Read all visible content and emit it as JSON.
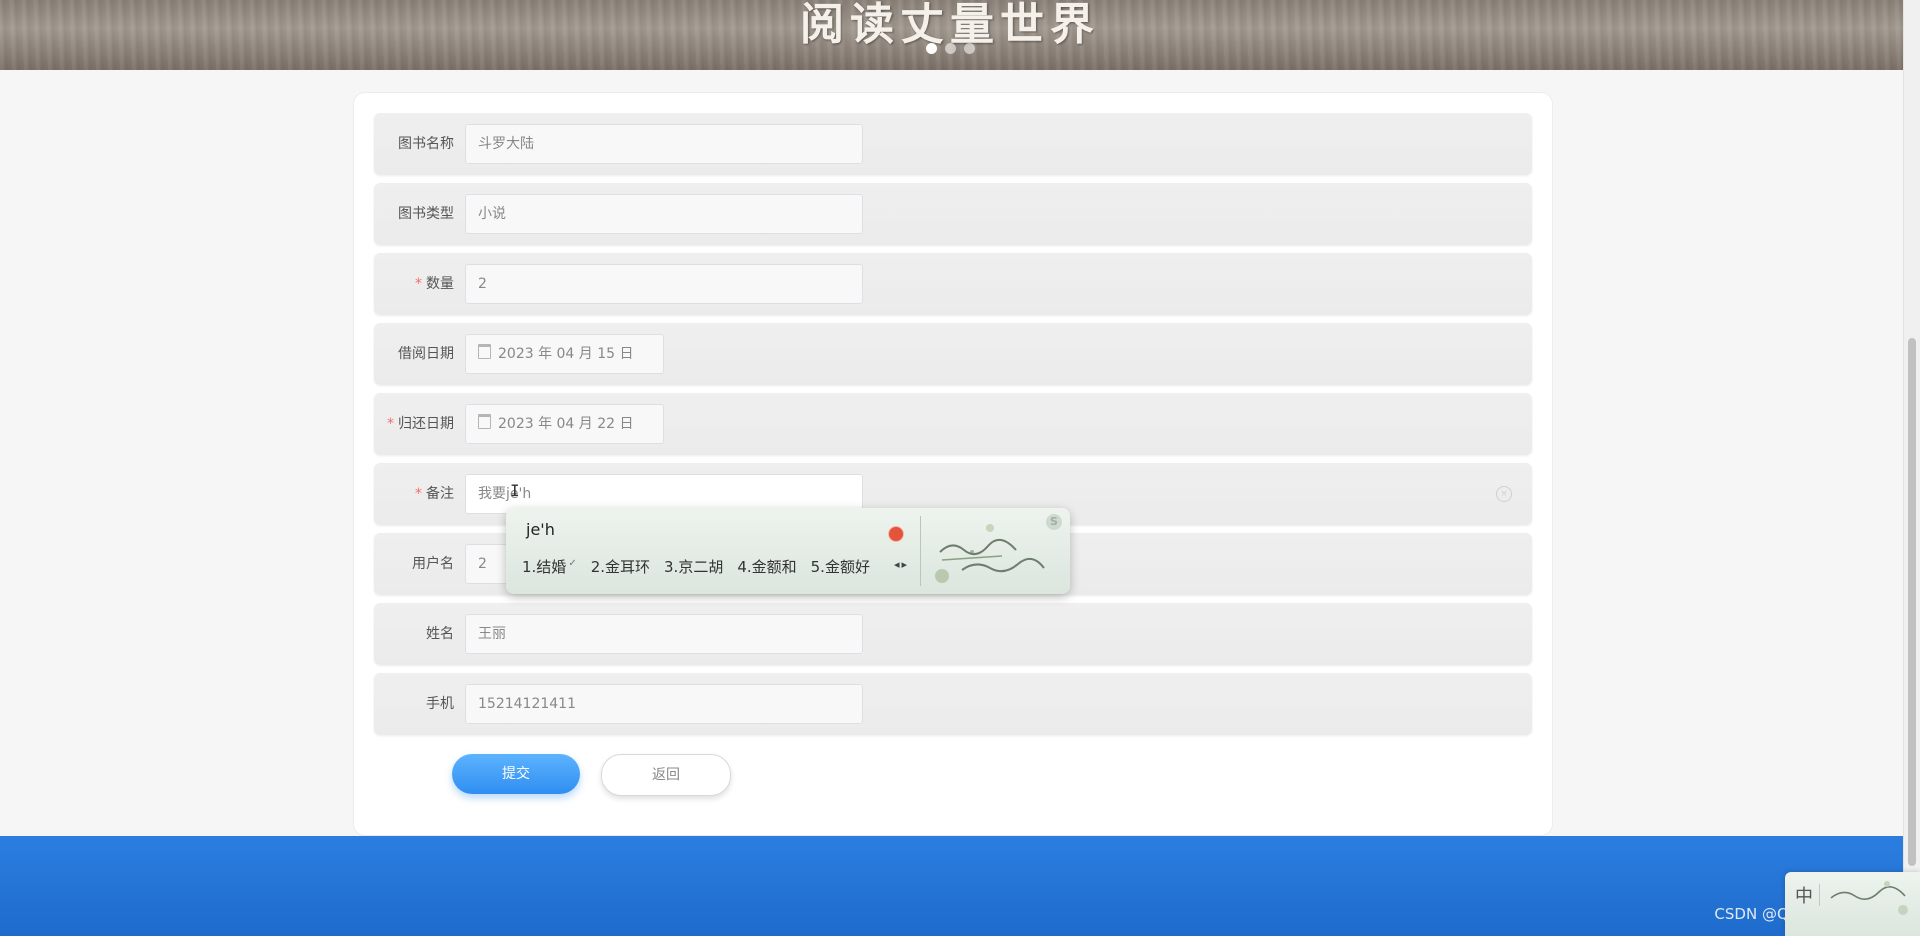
{
  "banner": {
    "title": "阅读丈量世界",
    "slides": 3,
    "active_slide": 1
  },
  "form": {
    "fields": [
      {
        "label": "图书名称",
        "value": "斗罗大陆",
        "required": false
      },
      {
        "label": "图书类型",
        "value": "小说",
        "required": false
      },
      {
        "label": "数量",
        "value": "2",
        "required": true
      },
      {
        "label": "借阅日期",
        "value": "2023 年 04 月 15 日",
        "required": false
      },
      {
        "label": "归还日期",
        "value": "2023 年 04 月 22 日",
        "required": true
      },
      {
        "label": "备注",
        "value": "我要je'h",
        "required": true
      },
      {
        "label": "用户名",
        "value": "2",
        "required": false
      },
      {
        "label": "姓名",
        "value": "王丽",
        "required": false
      },
      {
        "label": "手机",
        "value": "15214121411",
        "required": false
      }
    ],
    "required_mark": "*",
    "submit_label": "提交",
    "back_label": "返回"
  },
  "ime": {
    "composition": "je'h",
    "candidates": [
      "1.结婚",
      "2.金耳环",
      "3.京二胡",
      "4.金额和",
      "5.金额好"
    ],
    "toolbar_mode": "中",
    "logo_letter": "S"
  },
  "footer": {
    "watermark": "CSDN @QQ1694456137"
  }
}
